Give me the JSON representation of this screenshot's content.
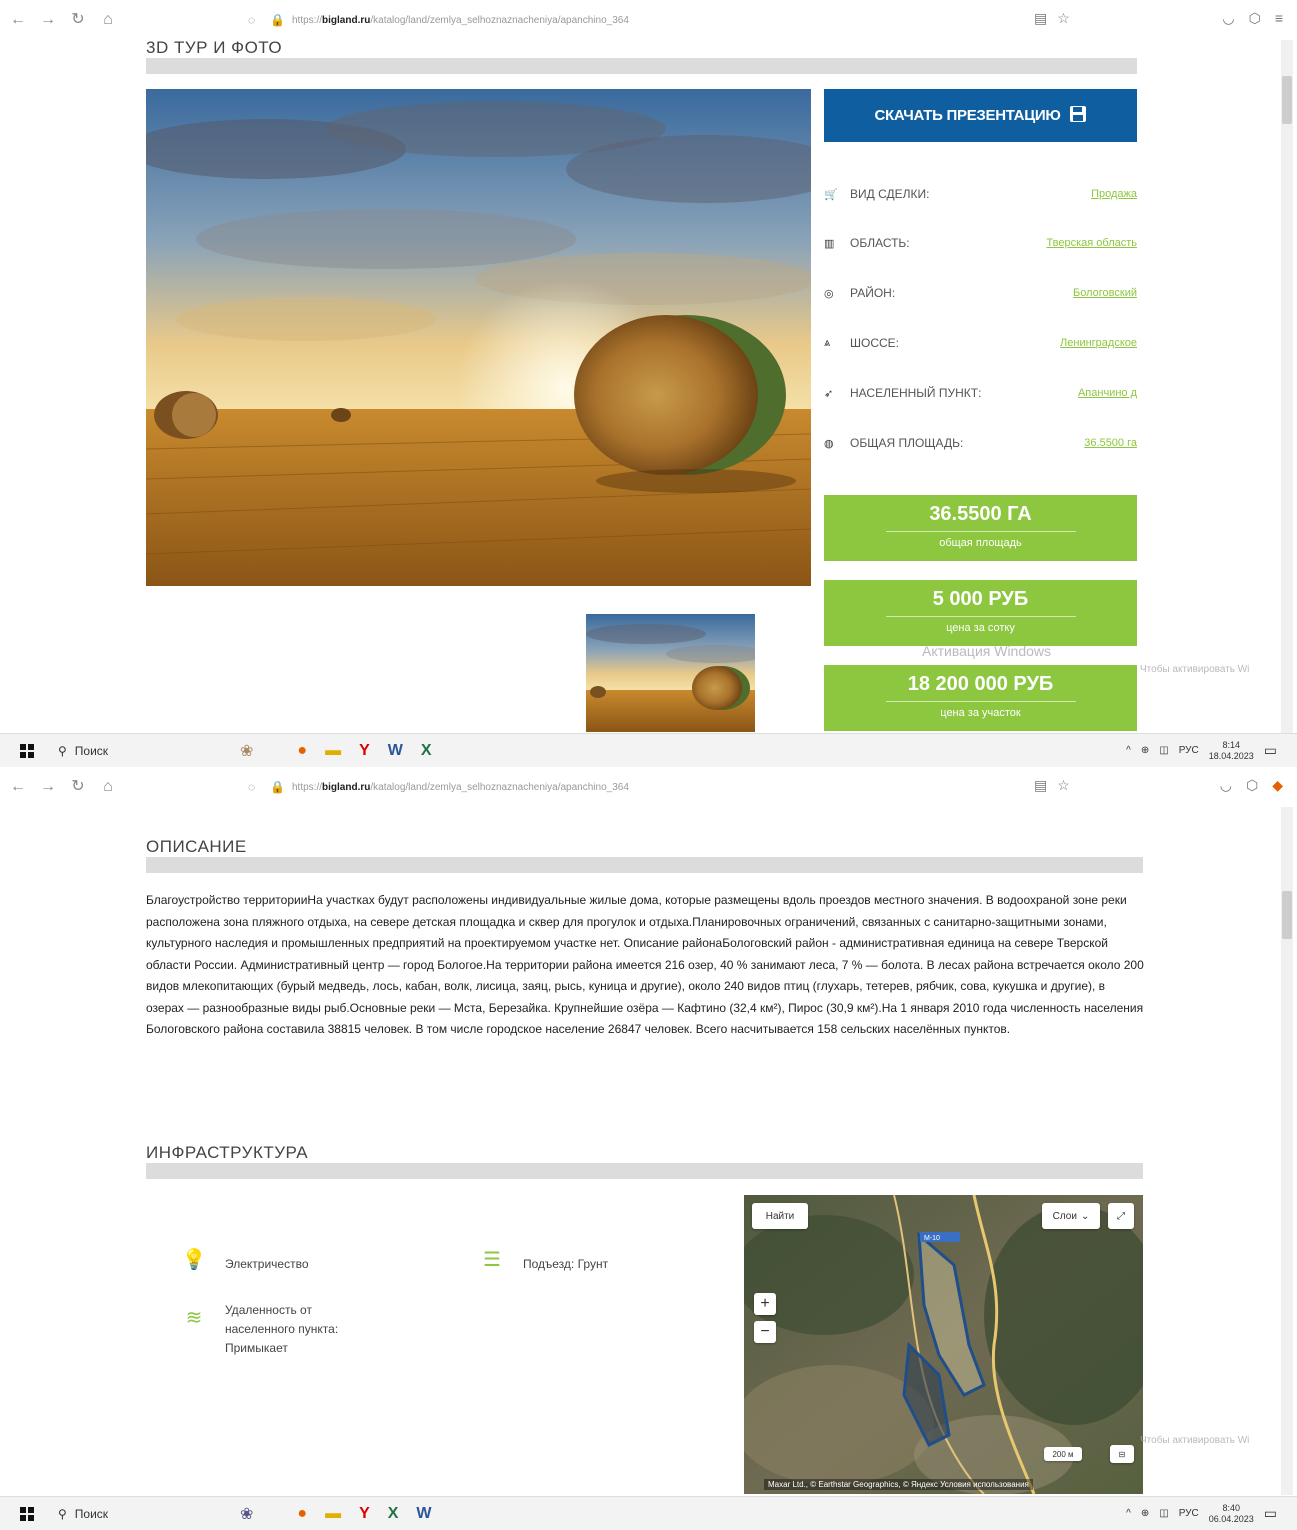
{
  "browser": {
    "url_prefix": "https://",
    "url_domain": "bigland.ru",
    "url_path": "/katalog/land/zemlya_selhoznaznacheniya/apanchino_364"
  },
  "top": {
    "section_title": "3D ТУР И ФОТО",
    "download_button": "СКАЧАТЬ ПРЕЗЕНТАЦИЮ",
    "info": [
      {
        "icon": "cart-icon",
        "label": "ВИД СДЕЛКИ:",
        "value": "Продажа"
      },
      {
        "icon": "map-icon",
        "label": "ОБЛАСТЬ:",
        "value": "Тверская область"
      },
      {
        "icon": "target-icon",
        "label": "РАЙОН:",
        "value": "Бологовский"
      },
      {
        "icon": "road-icon",
        "label": "ШОССЕ:",
        "value": "Ленинградское"
      },
      {
        "icon": "location-arrow-icon",
        "label": "НАСЕЛЕННЫЙ ПУНКТ:",
        "value": "Апанчино д"
      },
      {
        "icon": "globe-icon",
        "label": "ОБЩАЯ ПЛОЩАДЬ:",
        "value": "36.5500 га"
      }
    ],
    "stats": [
      {
        "value": "36.5500 ГА",
        "caption": "общая площадь"
      },
      {
        "value": "5 000 РУБ",
        "caption": "цена за сотку"
      },
      {
        "value": "18 200 000 РУБ",
        "caption": "цена за участок"
      }
    ],
    "watermark": "Активация Windows",
    "watermark2": "Чтобы активировать Windows, перейдите в раздел"
  },
  "taskbar": {
    "search": "Поиск",
    "lang": "РУС",
    "time_top": "8:14",
    "date_top": "18.04.2023",
    "time_bottom": "8:40",
    "date_bottom": "06.04.2023"
  },
  "bottom": {
    "desc_title": "ОПИСАНИЕ",
    "description": "Благоустройство территорииНа участках будут расположены индивидуальные жилые дома, которые размещены вдоль проездов местного значения.  В водоохраной зоне реки расположена зона пляжного отдыха, на севере детская площадка и сквер для прогулок и отдыха.Планировочных ограничений, связанных с санитарно-защитными зонами, культурного наследия и промышленных предприятий на проектируемом участке нет. Описание районаБологовский район - административная единица на севере Тверской области России. Административный центр — город Бологое.На территории района имеется 216 озер, 40 % занимают леса, 7 % — болота. В лесах района встречается около 200 видов млекопитающих (бурый медведь, лось, кабан, волк, лисица, заяц, рысь, куница и другие), около 240 видов птиц (глухарь, тетерев, рябчик, сова, кукушка и другие), в озерах — разнообразные виды рыб.Основные реки — Мста, Березайка. Крупнейшие озёра — Кафтино (32,4 км²), Пирос (30,9 км²).На 1 января 2010 года численность населения Бологовского района составила 38815 человек. В том числе городское население 26847 человек. Всего насчитывается 158 сельских населённых пунктов.",
    "infra_title": "ИНФРАСТРУКТУРА",
    "infra": {
      "electricity": "Электричество",
      "access_road": "Подъезд: Грунт",
      "distance": "Удаленность от населенного пункта: Примыкает"
    },
    "map": {
      "find": "Найти",
      "layers": "Слои",
      "zoom_in": "+",
      "zoom_out": "−",
      "scale": "200 м",
      "copyright": "Maxar Ltd., © Earthstar Geographics, © Яндекс Условия использования",
      "road_label": "М-10"
    }
  }
}
